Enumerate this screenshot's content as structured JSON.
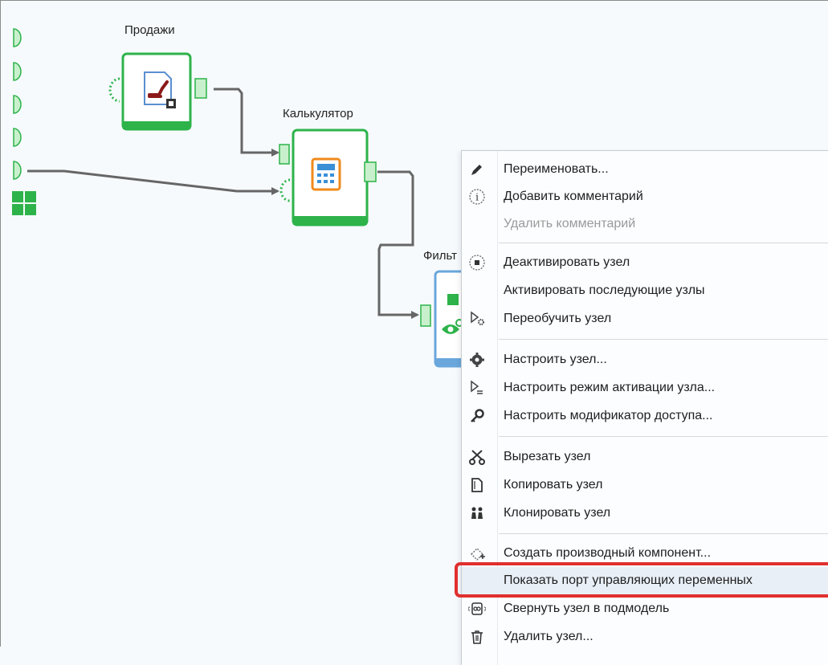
{
  "nodes": {
    "sales": {
      "label": "Продажи"
    },
    "calculator": {
      "label": "Калькулятор"
    },
    "filter": {
      "label": "Фильт"
    }
  },
  "colors": {
    "node_green": "#2db34a",
    "node_blue": "#6aa7dc",
    "port_fill": "#c9f0cc",
    "highlight_red": "#e0302e"
  },
  "context_menu": {
    "items": [
      {
        "label": "Переименовать...",
        "icon": "pencil-icon",
        "enabled": true
      },
      {
        "label": "Добавить комментарий",
        "icon": "info-icon",
        "enabled": true
      },
      {
        "label": "Удалить комментарий",
        "icon": "",
        "enabled": false
      },
      {
        "label": "Деактивировать узел",
        "icon": "stop-circle-icon",
        "enabled": true
      },
      {
        "label": "Активировать последующие узлы",
        "icon": "",
        "enabled": true
      },
      {
        "label": "Переобучить узел",
        "icon": "retrain-icon",
        "enabled": true
      },
      {
        "label": "Настроить узел...",
        "icon": "gear-icon",
        "enabled": true
      },
      {
        "label": "Настроить режим активации узла...",
        "icon": "activation-mode-icon",
        "enabled": true
      },
      {
        "label": "Настроить модификатор доступа...",
        "icon": "key-icon",
        "enabled": true
      },
      {
        "label": "Вырезать узел",
        "icon": "scissors-icon",
        "enabled": true
      },
      {
        "label": "Копировать узел",
        "icon": "copy-icon",
        "enabled": true
      },
      {
        "label": "Клонировать узел",
        "icon": "clone-icon",
        "enabled": true
      },
      {
        "label": "Создать производный компонент...",
        "icon": "derive-component-icon",
        "enabled": true
      },
      {
        "label": "Показать порт управляющих переменных",
        "icon": "",
        "enabled": true,
        "highlighted": true
      },
      {
        "label": "Свернуть узел в подмодель",
        "icon": "submodel-icon",
        "enabled": true
      },
      {
        "label": "Удалить узел...",
        "icon": "trash-icon",
        "enabled": true
      }
    ]
  }
}
